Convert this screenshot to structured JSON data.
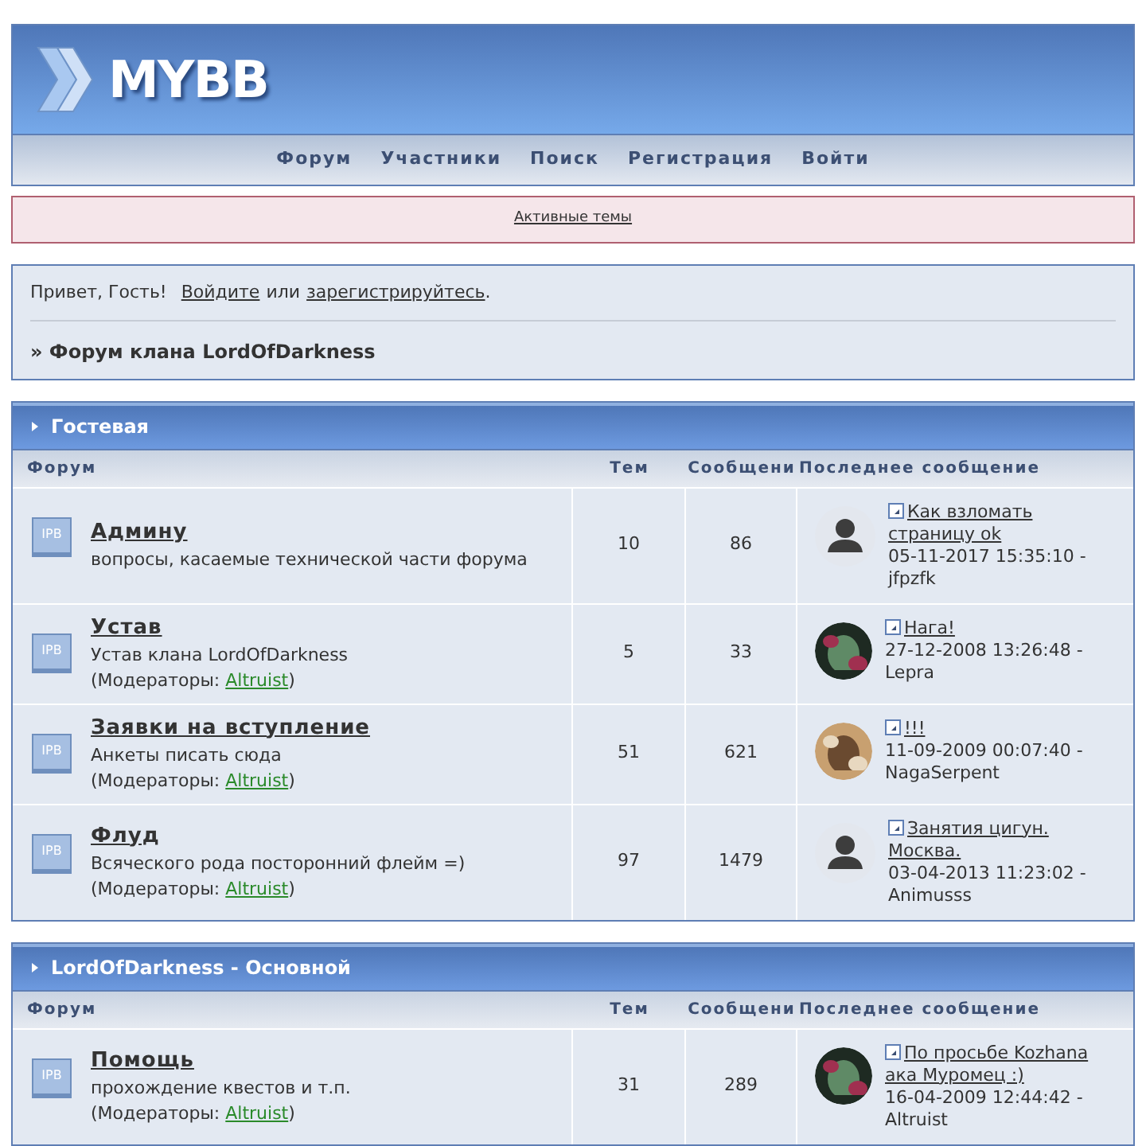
{
  "logo": {
    "text": "MYBB"
  },
  "nav": [
    "Форум",
    "Участники",
    "Поиск",
    "Регистрация",
    "Войти"
  ],
  "notice": {
    "link": "Активные темы"
  },
  "welcome": {
    "greeting": "Привет, Гость!",
    "login": "Войдите",
    "or": "или",
    "register": "зарегистрируйтесь",
    "end": "."
  },
  "breadcrumb": "» Форум клана LordOfDarkness",
  "categories": [
    {
      "title": "Гостевая",
      "columns": [
        "Форум",
        "Тем",
        "Сообщени",
        "Последнее сообщение"
      ],
      "forums": [
        {
          "icon": "IPB",
          "name": "Админу",
          "description": "вопросы, касаемые технической части форума",
          "topics": "10",
          "posts": "86",
          "last": {
            "avatar": {
              "kind": "default"
            },
            "title": "Как взломать страницу ok",
            "byline": "05-11-2017 15:35:10 - jfpzfk"
          }
        },
        {
          "icon": "IPB",
          "name": "Устав",
          "description": "Устав клана LordOfDarkness",
          "moderators": {
            "prefix": "(Модераторы: ",
            "name": "Altruist",
            "suffix": ")"
          },
          "topics": "5",
          "posts": "33",
          "last": {
            "title": "Нага!",
            "byline": "27-12-2008 13:26:48 - Lepra"
          }
        },
        {
          "icon": "IPB",
          "name": "Заявки на вступление",
          "description": "Анкеты писать сюда",
          "moderators": {
            "prefix": "(Модераторы: ",
            "name": "Altruist",
            "suffix": ")"
          },
          "topics": "51",
          "posts": "621",
          "last": {
            "title": "!!!",
            "byline": "11-09-2009 00:07:40 - NagaSerpent"
          }
        },
        {
          "icon": "IPB",
          "name": "Флуд",
          "description": "Всяческого рода посторонний флейм =)",
          "moderators": {
            "prefix": "(Модераторы: ",
            "name": "Altruist",
            "suffix": ")"
          },
          "topics": "97",
          "posts": "1479",
          "last": {
            "avatar": {
              "kind": "default"
            },
            "title": "Занятия цигун. Москва.",
            "byline": "03-04-2013 11:23:02 - Animusss"
          }
        }
      ]
    },
    {
      "title": "LordOfDarkness - Основной",
      "columns": [
        "Форум",
        "Тем",
        "Сообщени",
        "Последнее сообщение"
      ],
      "forums": [
        {
          "icon": "IPB",
          "name": "Помощь",
          "description": "прохождение квестов и т.п.",
          "moderators": {
            "prefix": "(Модераторы: ",
            "name": "Altruist",
            "suffix": ")"
          },
          "topics": "31",
          "posts": "289",
          "last": {
            "title": "По просьбе Kozhana ака Муромец :)",
            "byline": "16-04-2009 12:44:42 - Altruist"
          }
        }
      ]
    }
  ]
}
